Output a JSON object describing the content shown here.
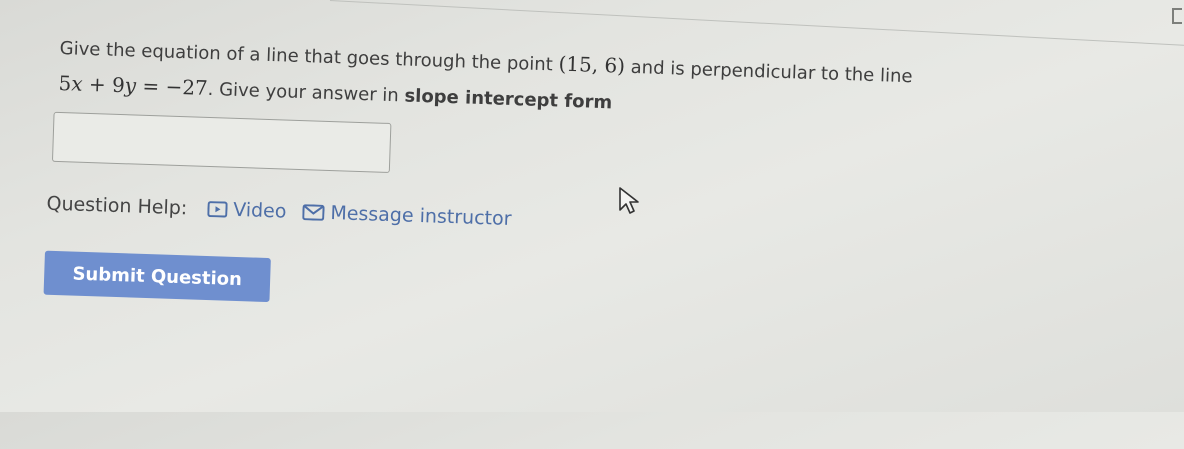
{
  "question": {
    "line1_text": "Give the equation of a line that goes through the point",
    "point": "(15, 6)",
    "line1_end": "and is perpendicular to the line",
    "line_equation": {
      "term1_coef": "5",
      "term1_var": "x",
      "plus": "+",
      "term2_coef": "9",
      "term2_var": "y",
      "equals": "=",
      "rhs": "−27"
    },
    "line2_text": ". Give your answer in",
    "emphasis": "slope intercept form"
  },
  "answer": {
    "value": ""
  },
  "help": {
    "label": "Question Help:",
    "video_label": "Video",
    "message_label": "Message instructor"
  },
  "submit": {
    "label": "Submit Question"
  },
  "colors": {
    "link": "#4e6fa8",
    "button": "#6f8fcf",
    "text": "#3e3e3e"
  },
  "icons": [
    "video-icon",
    "mail-icon",
    "cursor-icon",
    "corner-icon"
  ]
}
